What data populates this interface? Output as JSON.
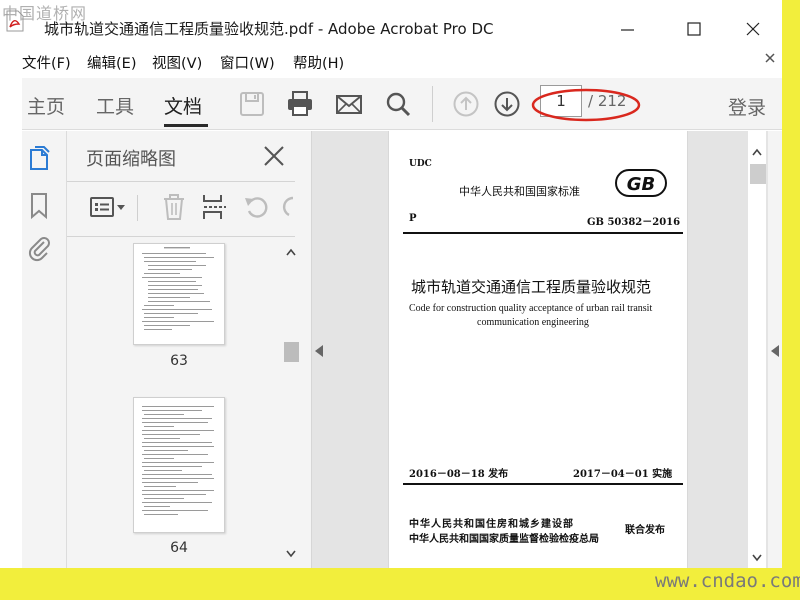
{
  "window": {
    "title": "城市轨道交通通信工程质量验收规范.pdf - Adobe Acrobat Pro DC"
  },
  "menu": [
    {
      "label": "文件(F)"
    },
    {
      "label": "编辑(E)"
    },
    {
      "label": "视图(V)"
    },
    {
      "label": "窗口(W)"
    },
    {
      "label": "帮助(H)"
    }
  ],
  "toolbar": {
    "tabs": [
      {
        "label": "主页",
        "active": false
      },
      {
        "label": "工具",
        "active": false
      },
      {
        "label": "文档",
        "active": true
      }
    ],
    "icons": [
      "save-icon",
      "print-icon",
      "email-icon",
      "search-icon",
      "page-up-icon",
      "page-down-icon"
    ],
    "page_current": "1",
    "page_total": "/ 212",
    "login": "登录"
  },
  "sidebar": {
    "icons": [
      "page-thumbnails-icon",
      "bookmark-icon",
      "attachment-icon"
    ]
  },
  "thumbnails": {
    "title": "页面缩略图",
    "items": [
      {
        "label": "63"
      },
      {
        "label": "64"
      }
    ]
  },
  "document": {
    "udc": "UDC",
    "standard_type": "中华人民共和国国家标准",
    "category": "P",
    "code": "GB 50382－2016",
    "title_cn": "城市轨道交通通信工程质量验收规范",
    "title_en_1": "Code for construction quality acceptance of urban rail transit",
    "title_en_2": "communication engineering",
    "issue_date": "2016－08－18  发布",
    "impl_date": "2017－04－01  实施",
    "issuer_1": "中华人民共和国住房和城乡建设部",
    "issuer_2": "中华人民共和国国家质量监督检验检疫总局",
    "joint": "联合发布"
  },
  "watermarks": {
    "top": "中国道桥网",
    "bottom": "www.cndao.com"
  },
  "colors": {
    "frame": "#f2ee3c",
    "annotation_red": "#d9281e",
    "toolbar_bg": "#f4f4f4"
  }
}
